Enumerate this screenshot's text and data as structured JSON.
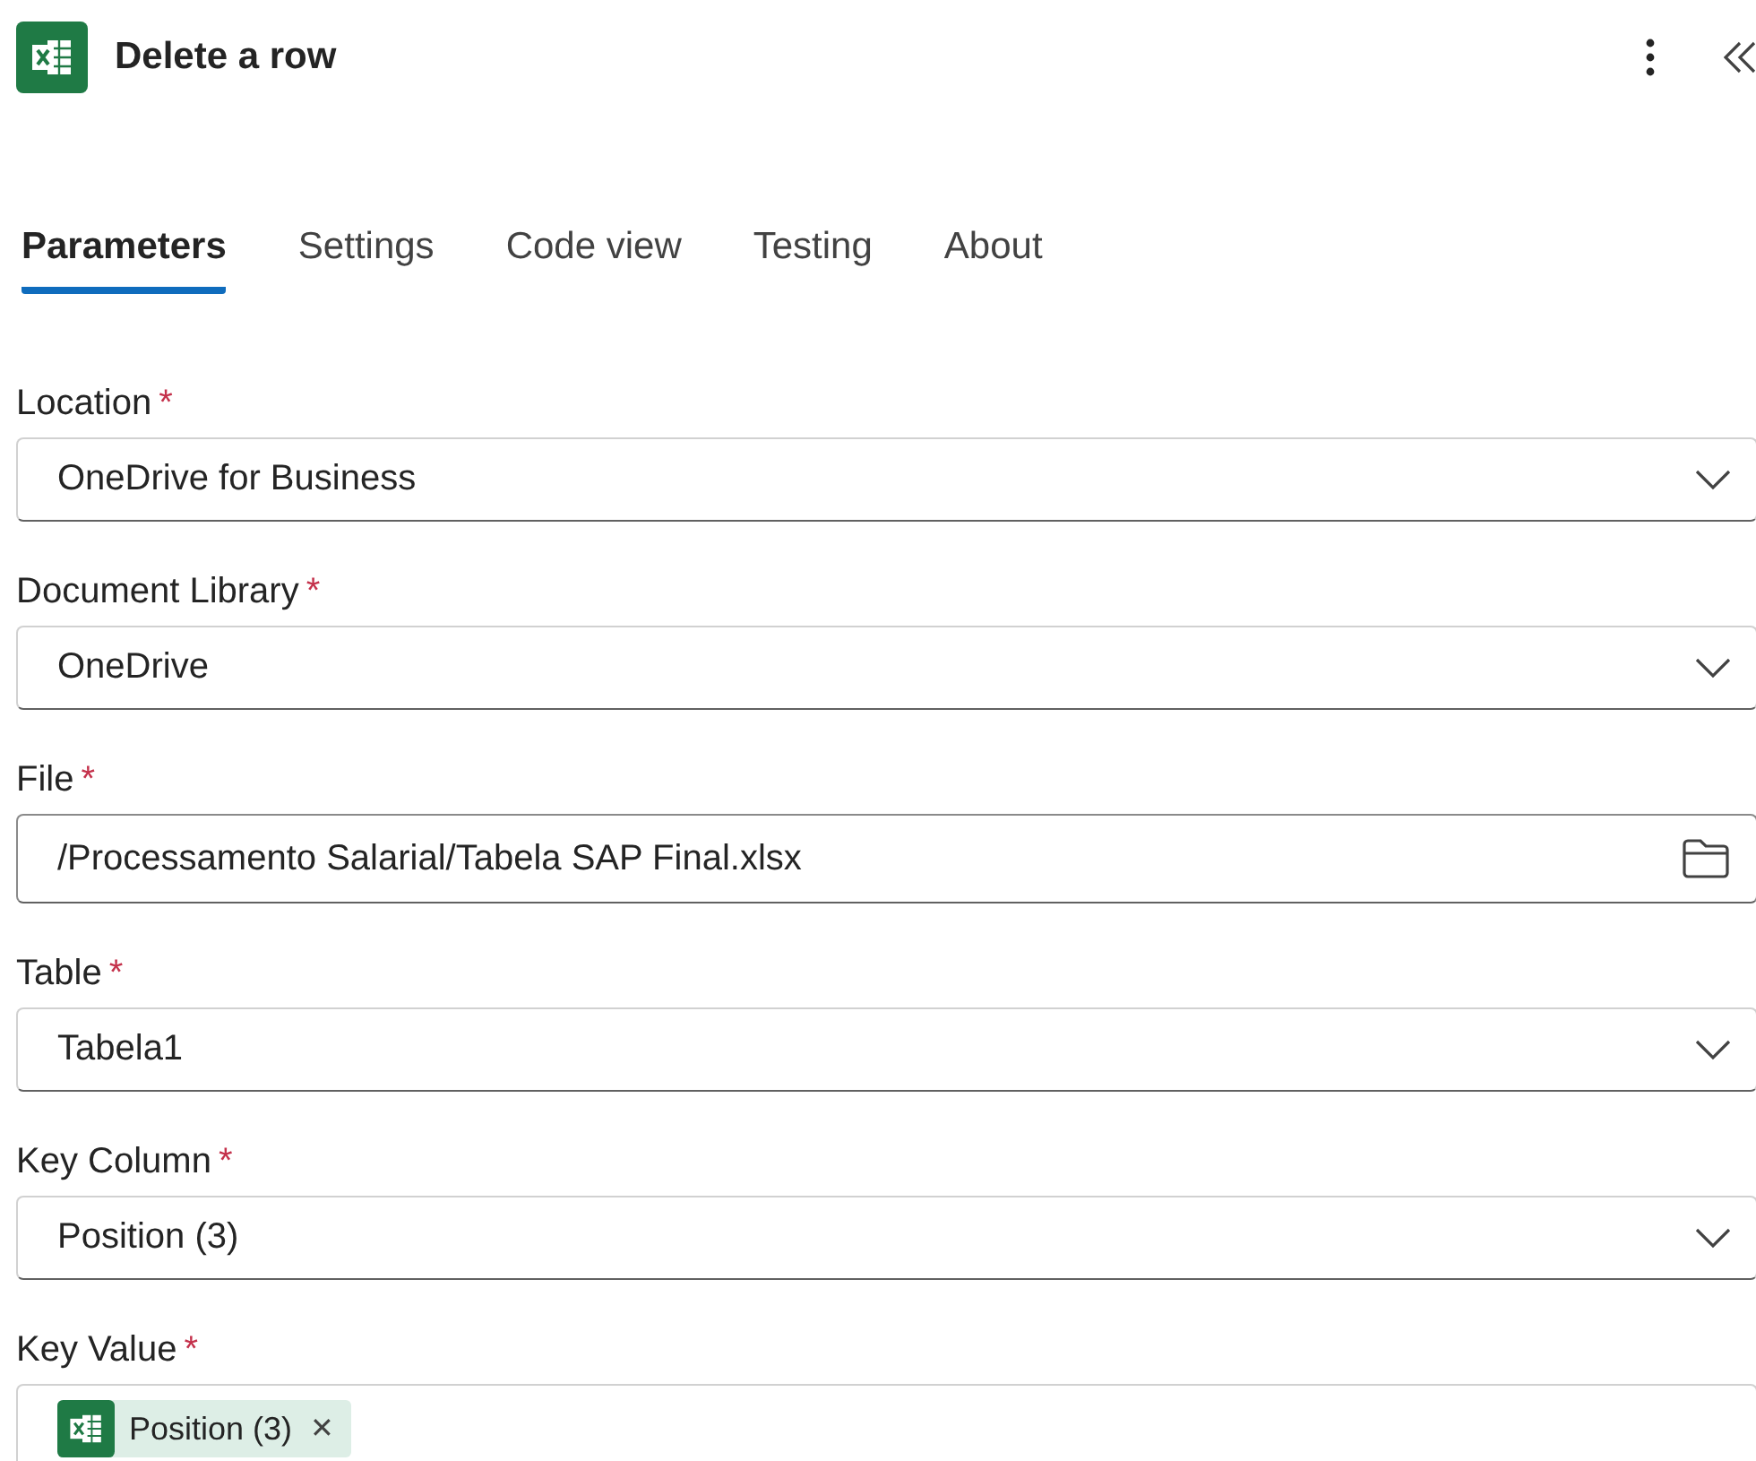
{
  "header": {
    "title": "Delete a row"
  },
  "tabs": [
    {
      "label": "Parameters",
      "selected": true
    },
    {
      "label": "Settings",
      "selected": false
    },
    {
      "label": "Code view",
      "selected": false
    },
    {
      "label": "Testing",
      "selected": false
    },
    {
      "label": "About",
      "selected": false
    }
  ],
  "fields": [
    {
      "kind": "dropdown",
      "label": "Location",
      "required_mark": "*",
      "value": "OneDrive for Business"
    },
    {
      "kind": "dropdown",
      "label": "Document Library",
      "required_mark": "*",
      "value": "OneDrive"
    },
    {
      "kind": "file",
      "label": "File",
      "required_mark": "*",
      "value": "/Processamento Salarial/Tabela SAP Final.xlsx"
    },
    {
      "kind": "dropdown",
      "label": "Table",
      "required_mark": "*",
      "value": "Tabela1"
    },
    {
      "kind": "dropdown",
      "label": "Key Column",
      "required_mark": "*",
      "value": "Position (3)"
    },
    {
      "kind": "tokens",
      "label": "Key Value",
      "required_mark": "*",
      "tokens": [
        {
          "label": "Position (3)",
          "remove": "✕"
        }
      ]
    }
  ]
}
